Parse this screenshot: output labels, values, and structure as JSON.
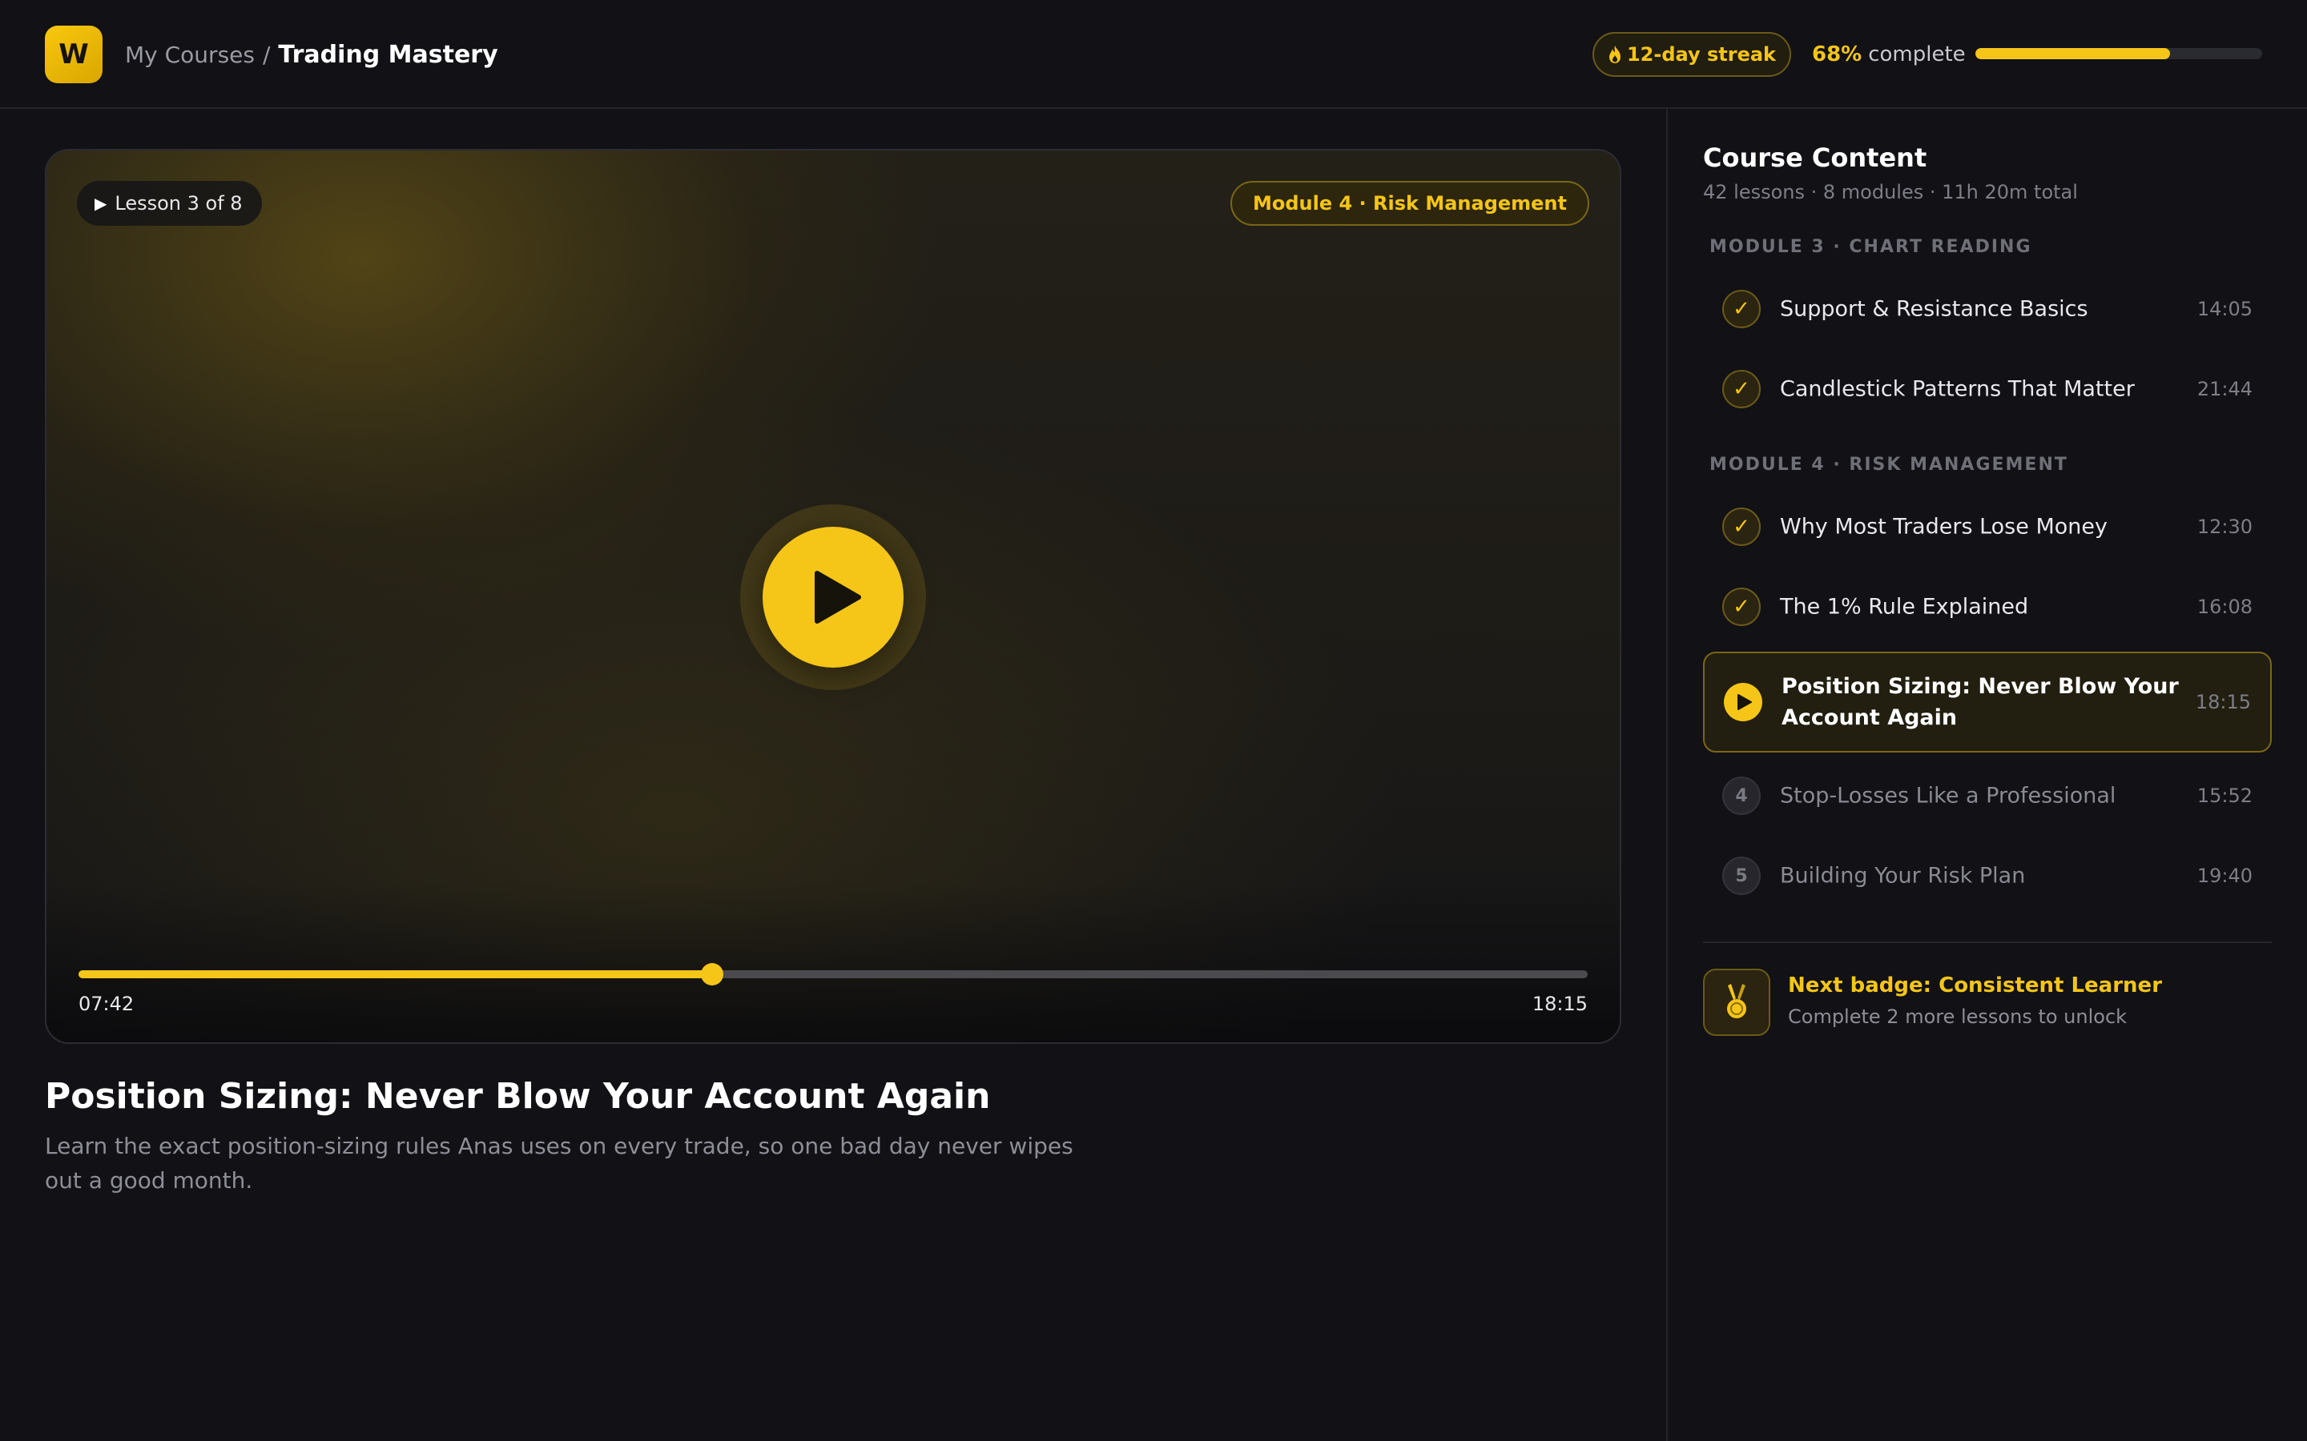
{
  "header": {
    "logo_text": "W",
    "breadcrumb_parent": "My Courses",
    "breadcrumb_separator": "/",
    "breadcrumb_current": "Trading Mastery",
    "streak_label": "12-day streak",
    "progress_percent_text": "68%",
    "progress_label": "complete",
    "progress_fraction": 0.68
  },
  "video": {
    "lesson_chip": "Lesson 3 of 8",
    "module_chip": "Module 4 · Risk Management",
    "current_time": "07:42",
    "duration": "18:15",
    "played_fraction": 0.42
  },
  "lesson": {
    "title": "Position Sizing: Never Blow Your Account Again",
    "description": "Learn the exact position-sizing rules Anas uses on every trade, so one bad day never wipes out a good month."
  },
  "sidebar": {
    "title": "Course Content",
    "subtitle": "42 lessons · 8 modules · 11h 20m total",
    "modules": [
      {
        "label": "MODULE 3 · CHART READING",
        "lessons": [
          {
            "status": "done",
            "name": "Support & Resistance Basics",
            "duration": "14:05"
          },
          {
            "status": "done",
            "name": "Candlestick Patterns That Matter",
            "duration": "21:44"
          }
        ]
      },
      {
        "label": "MODULE 4 · RISK MANAGEMENT",
        "lessons": [
          {
            "status": "done",
            "name": "Why Most Traders Lose Money",
            "duration": "12:30"
          },
          {
            "status": "done",
            "name": "The 1% Rule Explained",
            "duration": "16:08"
          },
          {
            "status": "active",
            "name": "Position Sizing: Never Blow Your Account Again",
            "duration": "18:15"
          },
          {
            "status": "locked",
            "number": "4",
            "name": "Stop-Losses Like a Professional",
            "duration": "15:52"
          },
          {
            "status": "locked",
            "number": "5",
            "name": "Building Your Risk Plan",
            "duration": "19:40"
          }
        ]
      }
    ],
    "badge": {
      "title": "Next badge: Consistent Learner",
      "subtitle": "Complete 2 more lessons to unlock"
    }
  },
  "colors": {
    "accent": "#f5c518",
    "background": "#111116"
  },
  "icons": {
    "streak": "flame-icon",
    "done": "check-icon",
    "active": "play-icon",
    "badge": "medal-icon"
  }
}
